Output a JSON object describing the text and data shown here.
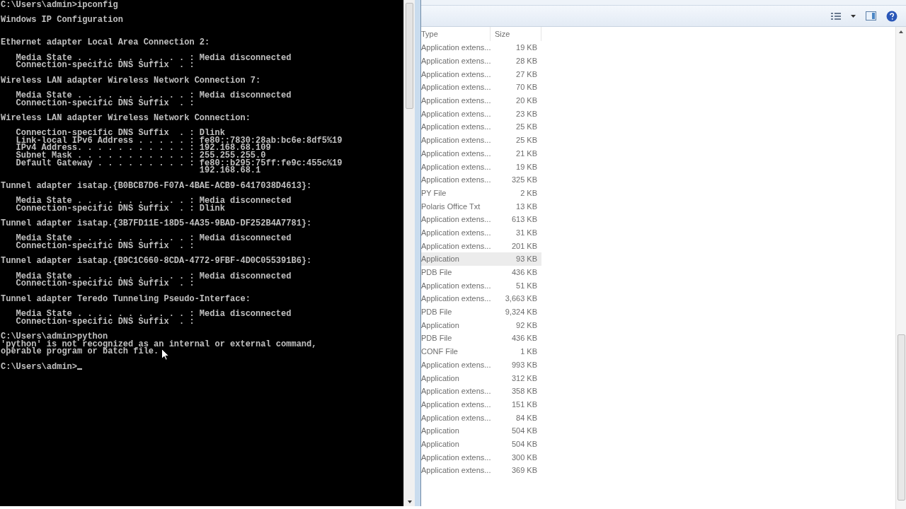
{
  "console": {
    "blocks": [
      {
        "kind": "plain",
        "lines": [
          "C:\\Users\\admin>ipconfig"
        ]
      },
      {
        "kind": "title",
        "lines": [
          "Windows IP Configuration"
        ]
      },
      {
        "kind": "plain",
        "lines": [
          "Ethernet adapter Local Area Connection 2:"
        ]
      },
      {
        "kind": "plain",
        "lines": [
          "   Media State . . . . . . . . . . . : Media disconnected",
          "   Connection-specific DNS Suffix  . :"
        ]
      },
      {
        "kind": "plain",
        "lines": [
          "Wireless LAN adapter Wireless Network Connection 7:"
        ]
      },
      {
        "kind": "plain",
        "lines": [
          "   Media State . . . . . . . . . . . : Media disconnected",
          "   Connection-specific DNS Suffix  . :"
        ]
      },
      {
        "kind": "plain",
        "lines": [
          "Wireless LAN adapter Wireless Network Connection:"
        ]
      },
      {
        "kind": "plain",
        "lines": [
          "   Connection-specific DNS Suffix  . : Dlink",
          "   Link-local IPv6 Address . . . . . : fe80::7830:28ab:bc6e:8df5%19",
          "   IPv4 Address. . . . . . . . . . . : 192.168.68.109",
          "   Subnet Mask . . . . . . . . . . . : 255.255.255.0",
          "   Default Gateway . . . . . . . . . : fe80::b295:75ff:fe9c:455c%19",
          "                                       192.168.68.1"
        ]
      },
      {
        "kind": "plain",
        "lines": [
          "Tunnel adapter isatap.{B0BCB7D6-F07A-4BAE-ACB9-6417038D4613}:"
        ]
      },
      {
        "kind": "plain",
        "lines": [
          "   Media State . . . . . . . . . . . : Media disconnected",
          "   Connection-specific DNS Suffix  . : Dlink"
        ]
      },
      {
        "kind": "plain",
        "lines": [
          "Tunnel adapter isatap.{3B7FD11E-18D5-4A35-9BAD-DF252B4A7781}:"
        ]
      },
      {
        "kind": "plain",
        "lines": [
          "   Media State . . . . . . . . . . . : Media disconnected",
          "   Connection-specific DNS Suffix  . :"
        ]
      },
      {
        "kind": "plain",
        "lines": [
          "Tunnel adapter isatap.{B9C1C660-8CDA-4772-9FBF-4D0C055391B6}:"
        ]
      },
      {
        "kind": "plain",
        "lines": [
          "   Media State . . . . . . . . . . . : Media disconnected",
          "   Connection-specific DNS Suffix  . :"
        ]
      },
      {
        "kind": "plain",
        "lines": [
          "Tunnel adapter Teredo Tunneling Pseudo-Interface:"
        ]
      },
      {
        "kind": "plain",
        "lines": [
          "   Media State . . . . . . . . . . . : Media disconnected",
          "   Connection-specific DNS Suffix  . :"
        ]
      },
      {
        "kind": "plain",
        "lines": [
          "C:\\Users\\admin>python",
          "'python' is not recognized as an internal or external command,",
          "operable program or batch file."
        ]
      },
      {
        "kind": "prompt",
        "lines": [
          "C:\\Users\\admin>"
        ]
      }
    ]
  },
  "explorer": {
    "columns": [
      "Type",
      "Size"
    ],
    "rows": [
      {
        "type": "Application extens...",
        "size": "19 KB",
        "selected": false
      },
      {
        "type": "Application extens...",
        "size": "28 KB",
        "selected": false
      },
      {
        "type": "Application extens...",
        "size": "27 KB",
        "selected": false
      },
      {
        "type": "Application extens...",
        "size": "70 KB",
        "selected": false
      },
      {
        "type": "Application extens...",
        "size": "20 KB",
        "selected": false
      },
      {
        "type": "Application extens...",
        "size": "23 KB",
        "selected": false
      },
      {
        "type": "Application extens...",
        "size": "25 KB",
        "selected": false
      },
      {
        "type": "Application extens...",
        "size": "25 KB",
        "selected": false
      },
      {
        "type": "Application extens...",
        "size": "21 KB",
        "selected": false
      },
      {
        "type": "Application extens...",
        "size": "19 KB",
        "selected": false
      },
      {
        "type": "Application extens...",
        "size": "325 KB",
        "selected": false
      },
      {
        "type": "PY File",
        "size": "2 KB",
        "selected": false
      },
      {
        "type": "Polaris Office Txt",
        "size": "13 KB",
        "selected": false
      },
      {
        "type": "Application extens...",
        "size": "613 KB",
        "selected": false
      },
      {
        "type": "Application extens...",
        "size": "31 KB",
        "selected": false
      },
      {
        "type": "Application extens...",
        "size": "201 KB",
        "selected": false
      },
      {
        "type": "Application",
        "size": "93 KB",
        "selected": true
      },
      {
        "type": "PDB File",
        "size": "436 KB",
        "selected": false
      },
      {
        "type": "Application extens...",
        "size": "51 KB",
        "selected": false
      },
      {
        "type": "Application extens...",
        "size": "3,663 KB",
        "selected": false
      },
      {
        "type": "PDB File",
        "size": "9,324 KB",
        "selected": false
      },
      {
        "type": "Application",
        "size": "92 KB",
        "selected": false
      },
      {
        "type": "PDB File",
        "size": "436 KB",
        "selected": false
      },
      {
        "type": "CONF File",
        "size": "1 KB",
        "selected": false
      },
      {
        "type": "Application extens...",
        "size": "993 KB",
        "selected": false
      },
      {
        "type": "Application",
        "size": "312 KB",
        "selected": false
      },
      {
        "type": "Application extens...",
        "size": "358 KB",
        "selected": false
      },
      {
        "type": "Application extens...",
        "size": "151 KB",
        "selected": false
      },
      {
        "type": "Application extens...",
        "size": "84 KB",
        "selected": false
      },
      {
        "type": "Application",
        "size": "504 KB",
        "selected": false
      },
      {
        "type": "Application",
        "size": "504 KB",
        "selected": false
      },
      {
        "type": "Application extens...",
        "size": "300 KB",
        "selected": false
      },
      {
        "type": "Application extens...",
        "size": "369 KB",
        "selected": false
      }
    ]
  }
}
